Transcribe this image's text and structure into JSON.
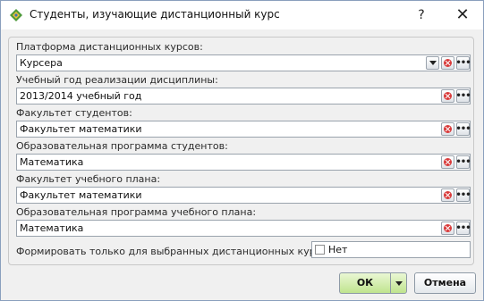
{
  "window": {
    "title": "Студенты, изучающие дистанционный курс",
    "help_label": "?",
    "close_label": "✕"
  },
  "fields": [
    {
      "label": "Платформа дистанционных курсов:",
      "value": "Курсера"
    },
    {
      "label": "Учебный год реализации дисциплины:",
      "value": "2013/2014 учебный год"
    },
    {
      "label": "Факультет студентов:",
      "value": "Факультет математики"
    },
    {
      "label": "Образовательная программа студентов:",
      "value": "Математика"
    },
    {
      "label": "Факультет учебного плана:",
      "value": "Факультет математики"
    },
    {
      "label": "Образовательная программа учебного плана:",
      "value": "Математика"
    }
  ],
  "only_selected": {
    "label": "Формировать только для выбранных дистанционных курсов:",
    "value_text": "Нет",
    "checked": false
  },
  "buttons": {
    "ok_label": "ОК",
    "cancel_label": "Отмена",
    "more_label": "•••"
  },
  "colors": {
    "ok_button": "#bfe48e",
    "clear_button": "#d93a3a"
  }
}
